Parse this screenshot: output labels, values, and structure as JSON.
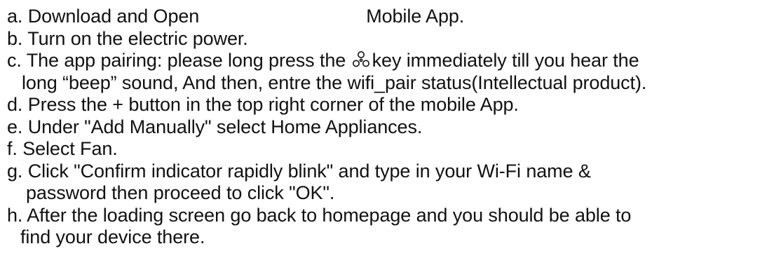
{
  "steps": {
    "a": {
      "part1": "a. Download and Open",
      "part2": "Mobile App."
    },
    "b": {
      "text": "b. Turn on the electric power."
    },
    "c": {
      "part1": "c. The app pairing: please long press the",
      "icon": "fan-icon",
      "part2": "key immediately till you hear the",
      "line2": "long “beep” sound, And then, entre the wifi_pair status(Intellectual product)."
    },
    "d": {
      "text": "d. Press the + button in the top right corner of the mobile App."
    },
    "e": {
      "text": "e. Under \"Add Manually\" select Home Appliances."
    },
    "f": {
      "text": "f. Select Fan."
    },
    "g": {
      "line1": "g. Click \"Confirm indicator rapidly blink\" and type in your Wi-Fi name &",
      "line2": "password then proceed to click \"OK\"."
    },
    "h": {
      "line1": "h. After the loading screen go back to homepage and you should be able to",
      "line2": "find your device there."
    }
  }
}
